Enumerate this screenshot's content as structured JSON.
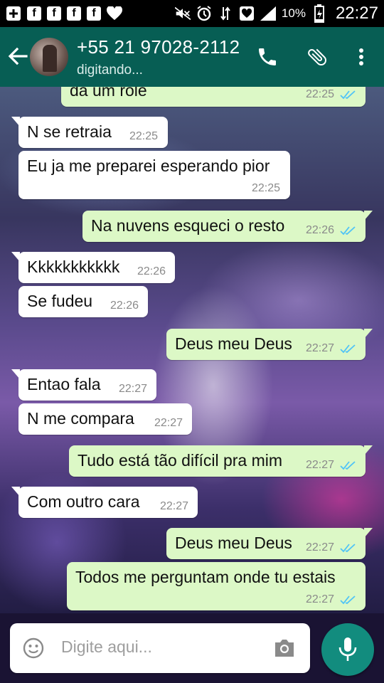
{
  "status_bar": {
    "icons": [
      "plus-box-icon",
      "facebook-icon",
      "facebook-icon",
      "facebook-icon",
      "facebook-icon",
      "heart-icon",
      "mute-icon",
      "alarm-icon",
      "data-arrows-icon",
      "heart-icon",
      "signal-icon"
    ],
    "battery_percent": "10%",
    "time": "22:27"
  },
  "header": {
    "contact_name": "+55 21 97028-2112",
    "subtitle": "digitando...",
    "icons": [
      "back-arrow-icon",
      "phone-icon",
      "paperclip-icon",
      "more-vert-icon"
    ]
  },
  "colors": {
    "header": "#075e54",
    "incoming_bubble": "#ffffff",
    "outgoing_bubble": "#dcf8c6",
    "read_ticks": "#4fc3f7",
    "mic_button": "#128c7e"
  },
  "messages": [
    {
      "direction": "out",
      "text": "da um role",
      "time": "22:25",
      "read": true
    },
    {
      "direction": "in",
      "text": "N se retraia",
      "time": "22:25"
    },
    {
      "direction": "in",
      "text": "Eu ja me preparei esperando pior",
      "time": "22:25"
    },
    {
      "direction": "out",
      "text": "Na nuvens esqueci o resto",
      "time": "22:26",
      "read": true
    },
    {
      "direction": "in",
      "text": "Kkkkkkkkkkk",
      "time": "22:26"
    },
    {
      "direction": "in",
      "text": "Se fudeu",
      "time": "22:26"
    },
    {
      "direction": "out",
      "text": "Deus meu Deus",
      "time": "22:27",
      "read": true
    },
    {
      "direction": "in",
      "text": "Entao fala",
      "time": "22:27"
    },
    {
      "direction": "in",
      "text": "N me compara",
      "time": "22:27"
    },
    {
      "direction": "out",
      "text": "Tudo está tão difícil pra mim",
      "time": "22:27",
      "read": true
    },
    {
      "direction": "in",
      "text": "Com outro cara",
      "time": "22:27"
    },
    {
      "direction": "out",
      "text": "Deus meu Deus",
      "time": "22:27",
      "read": true
    },
    {
      "direction": "out",
      "text": "Todos me perguntam onde tu estais",
      "time": "22:27",
      "read": true
    }
  ],
  "composer": {
    "placeholder": "Digite aqui...",
    "icons": [
      "emoji-icon",
      "camera-icon",
      "microphone-icon"
    ]
  }
}
